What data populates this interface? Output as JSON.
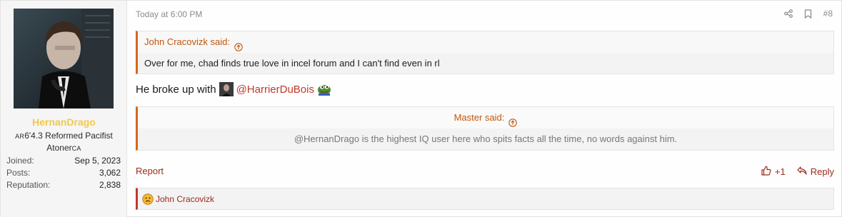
{
  "user": {
    "name": "HernanDrago",
    "title_prefix": "AR",
    "title_main": "6'4.3 Reformed Pacifist",
    "title_line2": "Atoner",
    "title_suffix": "CA",
    "stats": [
      {
        "label": "Joined:",
        "value": "Sep 5, 2023"
      },
      {
        "label": "Posts:",
        "value": "3,062"
      },
      {
        "label": "Reputation:",
        "value": "2,838"
      }
    ]
  },
  "post": {
    "timestamp": "Today at 6:00 PM",
    "number": "#8",
    "quote1": {
      "author": "John Cracovizk said:",
      "text": "Over for me, chad finds true love in incel forum and I can't find even in rl"
    },
    "content_prefix": "He broke up with",
    "mention": "@HarrierDuBois",
    "quote2": {
      "author": "Master said:",
      "text": "@HernanDrago is the highest IQ user here who spits facts all the time, no words against him."
    },
    "report_label": "Report",
    "like_count": "+1",
    "reply_label": "Reply",
    "reaction_user": "John Cracovizk"
  },
  "icons": {
    "share": "share-icon",
    "bookmark": "bookmark-icon",
    "quote_arrow": "circle-arrow-up-icon",
    "like": "thumbs-up-icon",
    "reply": "reply-arrow-icon",
    "reaction": "sad-face-icon",
    "emoji": "pepe-frog-icon"
  },
  "colors": {
    "accent": "#c0560d",
    "link": "#c0392b",
    "username": "#f2c94c"
  }
}
